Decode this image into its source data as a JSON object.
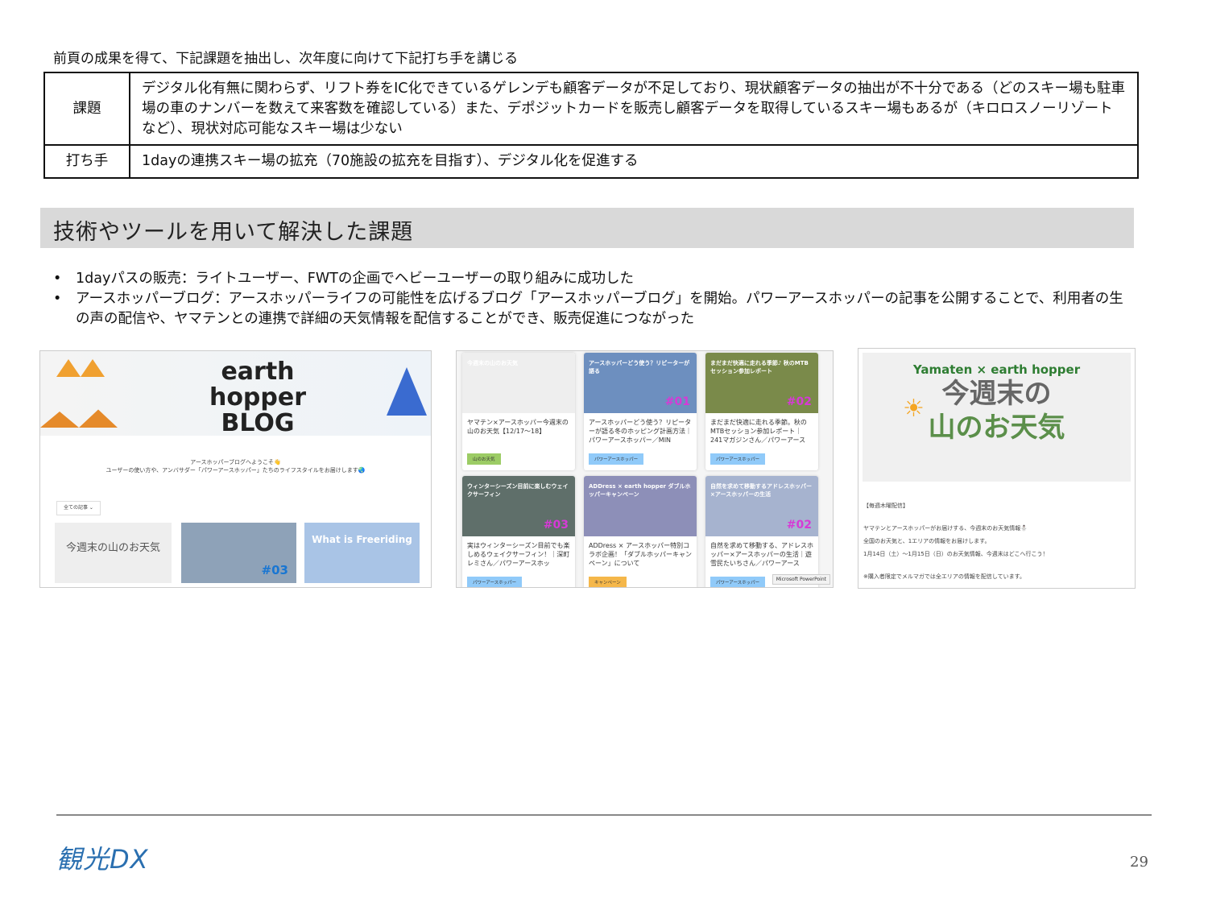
{
  "intro": "前頁の成果を得て、下記課題を抽出し、次年度に向けて下記打ち手を講じる",
  "table": [
    {
      "label": "課題",
      "text": "デジタル化有無に関わらず、リフト券をIC化できているゲレンデも顧客データが不足しており、現状顧客データの抽出が不十分である（どのスキー場も駐車場の車のナンバーを数えて来客数を確認している）また、デポジットカードを販売し顧客データを取得しているスキー場もあるが（キロロスノーリゾートなど）、現状対応可能なスキー場は少ない"
    },
    {
      "label": "打ち手",
      "text": "1dayの連携スキー場の拡充（70施設の拡充を目指す）、デジタル化を促進する"
    }
  ],
  "section_title": "技術やツールを用いて解決した課題",
  "bullets": [
    "1dayパスの販売：ライトユーザー、FWTの企画でヘビーユーザーの取り組みに成功した",
    "アースホッパーブログ：アースホッパーライフの可能性を広げるブログ「アースホッパーブログ」を開始。パワーアースホッパーの記事を公開することで、利用者の生の声の配信や、ヤマテンとの連携で詳細の天気情報を配信することができ、販売促進につながった"
  ],
  "shot1": {
    "logo": "earth hopper BLOG",
    "welcome": "アースホッパーブログへようこそ👋",
    "sub": "ユーザーの使い方や、アンバサダー「パワーアースホッパー」たちのライフスタイルをお届けします🌏",
    "filter": "全ての記事",
    "thumbs": [
      "今週末の山のお天気",
      "#03",
      "What is Freeriding"
    ]
  },
  "shot2": {
    "cards": [
      {
        "img": "今週末の山のお天気",
        "num": "",
        "title": "ヤマテン×アースホッパー今週末の山のお天気【12/17〜18】",
        "tag": "山のお天気",
        "tagColor": "#9ccc65",
        "imgColor": "#eeeeee"
      },
      {
        "img": "アースホッパーどう使う？リピーターが語る",
        "num": "#01",
        "title": "アースホッパーどう使う？リピーターが語る冬のホッピング計画方法｜パワーアースホッパー／MIN",
        "tag": "パワーアースホッパー",
        "tagColor": "#90caf9",
        "imgColor": "#6d8fbf"
      },
      {
        "img": "まだまだ快適に走れる季節♪ 秋のMTBセッション参加レポート",
        "num": "#02",
        "title": "まだまだ快適に走れる季節。秋のMTBセッション参加レポート｜241マガジンさん／パワーアース",
        "tag": "パワーアースホッパー",
        "tagColor": "#90caf9",
        "imgColor": "#7a8a4a"
      },
      {
        "img": "ウィンターシーズン目前に楽しむウェイクサーフィン",
        "num": "#03",
        "title": "実はウィンターシーズン目前でも楽しめるウェイクサーフィン！｜深町レミさん／パワーアースホッ",
        "tag": "パワーアースホッパー",
        "tagColor": "#90caf9",
        "imgColor": "#5f6f6a"
      },
      {
        "img": "ADDress × earth hopper ダブルホッパーキャンペーン",
        "num": "",
        "title": "ADDress × アースホッパー特別コラボ企画！「ダブルホッパーキャンペーン」について",
        "tag": "キャンペーン",
        "tagColor": "#f5b74a",
        "imgColor": "#8d8fb8"
      },
      {
        "img": "自然を求めて移動するアドレスホッパー×アースホッパーの生活",
        "num": "#02",
        "title": "自然を求めて移動する、アドレスホッパー×アースホッパーの生活｜遊雪民たいちさん／パワーアース",
        "tag": "パワーアースホッパー",
        "tagColor": "#90caf9",
        "imgColor": "#a6b3cf"
      }
    ],
    "tooltip": "Microsoft PowerPoint"
  },
  "shot3": {
    "logo": "Yamaten × earth hopper",
    "headline1": "今週末の",
    "headline2": "山のお天気",
    "lines": [
      "【毎週木曜配信】",
      "ヤマテンとアースホッパーがお届けする、今週末のお天気情報⛄",
      "全国のお天気と、1エリアの情報をお届けします。",
      "1月14日（土）〜1月15日（日）のお天気情報、今週末はどこへ行こう！",
      "※購入者限定でメルマガでは全エリアの情報を配信しています。"
    ]
  },
  "footer": {
    "logo": "観光DX",
    "page": "29"
  }
}
